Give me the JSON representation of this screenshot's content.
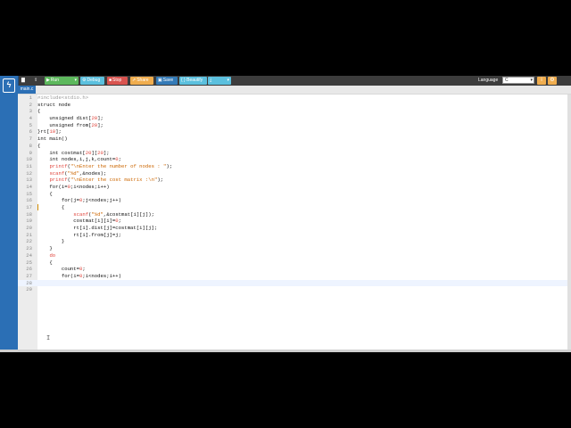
{
  "toolbar": {
    "run": "Run",
    "debug": "Debug",
    "stop": "Stop",
    "share": "Share",
    "save": "Save",
    "beautify": "{ } Beautify",
    "language_label": "Language",
    "language_value": "C"
  },
  "file_tab": "main.c",
  "colors": {
    "brand": "#2b6fb5",
    "run": "#5cb85c",
    "debug": "#5bc0de",
    "stop": "#d9534f",
    "share": "#f0ad4e",
    "save": "#337ab7"
  },
  "icons": [
    "logo-icon",
    "new-file-icon",
    "upload-icon",
    "play-icon",
    "bug-icon",
    "stop-icon",
    "share-icon",
    "save-icon",
    "download-icon",
    "info-icon",
    "settings-icon"
  ],
  "code_lines": [
    {
      "num": "1",
      "text": "#include<stdio.h>"
    },
    {
      "num": "2",
      "text": "struct node"
    },
    {
      "num": "3",
      "text": "{"
    },
    {
      "num": "4",
      "text": "    unsigned dist[20];"
    },
    {
      "num": "5",
      "text": "    unsigned from[20];"
    },
    {
      "num": "6",
      "text": "}rt[10];"
    },
    {
      "num": "7",
      "text": "int main()"
    },
    {
      "num": "8",
      "text": "{"
    },
    {
      "num": "9",
      "text": "    int costmat[20][20];"
    },
    {
      "num": "10",
      "text": "    int nodes,i,j,k,count=0;"
    },
    {
      "num": "11",
      "text": "    printf(\"\\nEnter the number of nodes : \");"
    },
    {
      "num": "12",
      "text": "    scanf(\"%d\",&nodes);"
    },
    {
      "num": "13",
      "text": "    printf(\"\\nEnter the cost matrix :\\n\");"
    },
    {
      "num": "14",
      "text": "    for(i=0;i<nodes;i++)"
    },
    {
      "num": "15",
      "text": "    {"
    },
    {
      "num": "16",
      "text": "        for(j=0;j<nodes;j++)"
    },
    {
      "num": "17",
      "text": "        {"
    },
    {
      "num": "18",
      "text": "            scanf(\"%d\",&costmat[i][j]);"
    },
    {
      "num": "19",
      "text": "            costmat[i][i]=0;"
    },
    {
      "num": "20",
      "text": "            rt[i].dist[j]=costmat[i][j];"
    },
    {
      "num": "21",
      "text": "            rt[i].from[j]=j;"
    },
    {
      "num": "22",
      "text": "        }"
    },
    {
      "num": "23",
      "text": "    }"
    },
    {
      "num": "24",
      "text": "    do"
    },
    {
      "num": "25",
      "text": "    {"
    },
    {
      "num": "26",
      "text": "        count=0;"
    },
    {
      "num": "27",
      "text": "        for(i=0;i<nodes;i++)"
    },
    {
      "num": "28",
      "text": ""
    },
    {
      "num": "29",
      "text": ""
    }
  ]
}
